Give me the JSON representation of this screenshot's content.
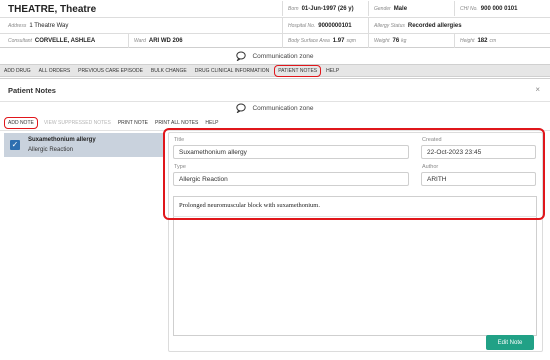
{
  "patient": {
    "name": "THEATRE, Theatre",
    "born_label": "Born",
    "born_value": "01-Jun-1997 (26 y)",
    "gender_label": "Gender",
    "gender_value": "Male",
    "chi_label": "CHI No.",
    "chi_value": "900 000 0101",
    "address_label": "Address",
    "address_value": "1 Theatre Way",
    "hospital_label": "Hospital No.",
    "hospital_value": "9000000101",
    "allergy_label": "Allergy Status",
    "allergy_value": "Recorded allergies",
    "consultant_label": "Consultant",
    "consultant_value": "CORVELLE, ASHLEA",
    "ward_label": "Ward",
    "ward_value": "ARI WD 206",
    "bsa_label": "Body Surface Area",
    "bsa_value": "1.97",
    "bsa_unit": "sqm",
    "weight_label": "Weight",
    "weight_value": "76",
    "weight_unit": "kg",
    "height_label": "Height",
    "height_value": "182",
    "height_unit": "cm"
  },
  "communication_zone": "Communication zone",
  "toolbar": {
    "items": [
      "ADD DRUG",
      "ALL ORDERS",
      "PREVIOUS CARE EPISODE",
      "BULK CHANGE",
      "DRUG CLINICAL INFORMATION",
      "PATIENT NOTES",
      "HELP"
    ]
  },
  "modal": {
    "title": "Patient Notes",
    "close": "×",
    "communication_zone": "Communication zone",
    "actions": [
      "ADD NOTE",
      "VIEW SUPPRESSED NOTES",
      "PRINT NOTE",
      "PRINT ALL NOTES",
      "HELP"
    ]
  },
  "note_list": [
    {
      "title": "Suxamethonium allergy",
      "type": "Allergic Reaction"
    }
  ],
  "note_detail": {
    "title_label": "Title",
    "title_value": "Suxamethonium allergy",
    "created_label": "Created",
    "created_value": "22-Oct-2023 23:45",
    "type_label": "Type",
    "type_value": "Allergic Reaction",
    "author_label": "Author",
    "author_value": "ARITH",
    "body": "Prolonged neuromuscular block with suxamethonium."
  },
  "edit_button": "Edit Note",
  "colors": {
    "accent_green": "#21a186",
    "highlight_red": "#e0161b",
    "selected_row": "#c9d2dd",
    "checkbox_blue": "#2e6fb0"
  }
}
